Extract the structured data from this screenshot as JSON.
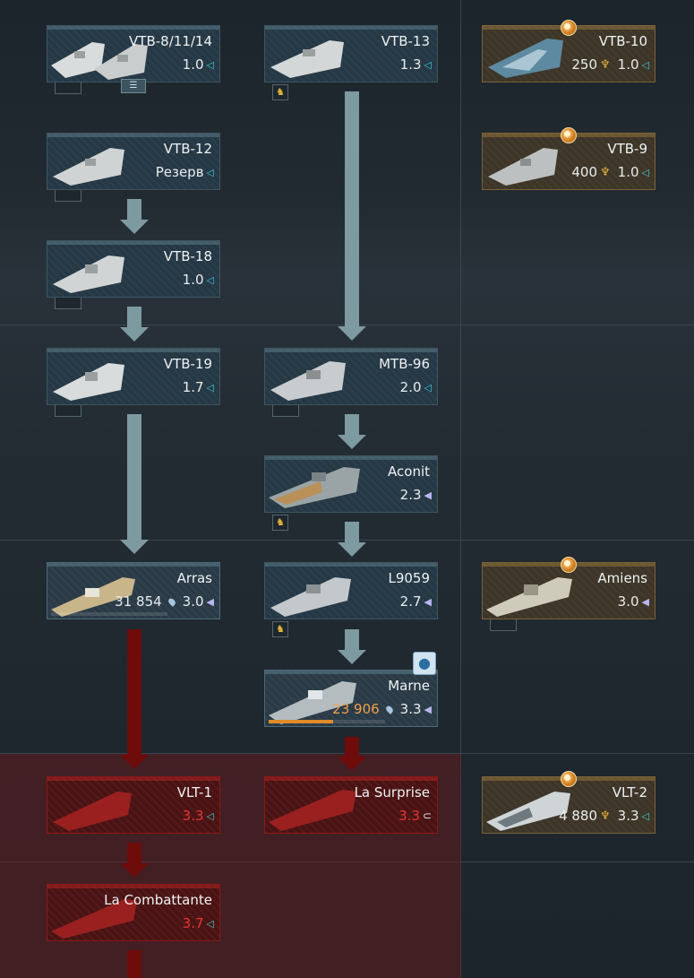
{
  "colors": {
    "accent_teal": "#3ec7d6",
    "locked_red": "#e53636",
    "premium_gold": "#e2b23d",
    "research_orange": "#f0a04c"
  },
  "vehicles": {
    "vtb_8": {
      "name": "VTB-8/11/14",
      "br": "1.0"
    },
    "vtb_13": {
      "name": "VTB-13",
      "br": "1.3"
    },
    "vtb_10": {
      "name": "VTB-10",
      "cost": "250",
      "br": "1.0"
    },
    "vtb_12": {
      "name": "VTB-12",
      "br": "Резерв"
    },
    "vtb_9": {
      "name": "VTB-9",
      "cost": "400",
      "br": "1.0"
    },
    "vtb_18": {
      "name": "VTB-18",
      "br": "1.0"
    },
    "vtb_19": {
      "name": "VTB-19",
      "br": "1.7"
    },
    "mtb_96": {
      "name": "MTB-96",
      "br": "2.0"
    },
    "aconit": {
      "name": "Aconit",
      "br": "2.3"
    },
    "arras": {
      "name": "Arras",
      "rp": "31 854",
      "br": "3.0"
    },
    "l9059": {
      "name": "L9059",
      "br": "2.7"
    },
    "amiens": {
      "name": "Amiens",
      "br": "3.0"
    },
    "marne": {
      "name": "Marne",
      "rp": "23 906",
      "br": "3.3",
      "progress": 0.55
    },
    "vlt_1": {
      "name": "VLT-1",
      "br": "3.3"
    },
    "la_surprise": {
      "name": "La Surprise",
      "br": "3.3"
    },
    "vlt_2": {
      "name": "VLT-2",
      "cost": "4 880",
      "br": "3.3"
    },
    "la_combattante": {
      "name": "La Combattante",
      "br": "3.7"
    }
  }
}
